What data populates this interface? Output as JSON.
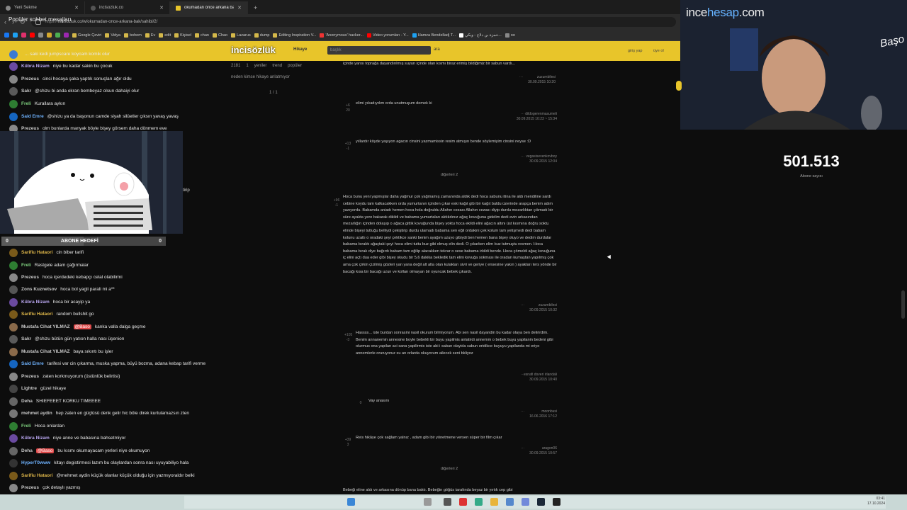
{
  "browser": {
    "tabs": [
      {
        "label": "Yeni Sekme"
      },
      {
        "label": "incisozluk.co"
      },
      {
        "label": "okumadan önce arkana bak - i..."
      }
    ],
    "new_tab": "+",
    "url_prefix": "https://",
    "url": "incisozluk.co/w/okumadan-once-arkana-bak/sahibi/2/",
    "back": "‹",
    "forward": "›",
    "reload": "↻",
    "bookmarks": [
      "Google Çeviri",
      "Vidya",
      "bohem",
      "Ev",
      "edit",
      "Kişisel",
      "chan",
      "Chao",
      "Lazarus",
      "dump",
      "Editing Inspiration V...",
      "'Anonymous' hacker...",
      "Video yorumları - Y...",
      "Hamza Bendelladj T...",
      "حمزة بن دلاج - ويكي...",
      "oo"
    ]
  },
  "site": {
    "logo": "incisözlük",
    "story_link": "Hikaye",
    "search_placeholder": "başlık",
    "search_button": "ara",
    "login": "giriş yap",
    "register": "üye ol",
    "thread_count": "2181",
    "tabs": [
      "1",
      "yeniler",
      "trend",
      "popüler"
    ],
    "subtitle": "neden kimse hikaye anlatmıyor",
    "page": "1 / 1"
  },
  "entries": [
    {
      "text": "içinde yarısı toprağa dayandırılmış suyun içinde olan kısmı biraz erimiş bildiğimiz bir sabun vardı...",
      "author": "zuzumbilesi",
      "date": "30.09.2015 10:20",
      "votes": ""
    },
    {
      "text": "elimi yıkadıydım orda unutmuşum demek ki",
      "author": "dildogerenmasumeli",
      "date": "30.09.2015 10:23 ~ 15:34",
      "votes": "+6 20"
    },
    {
      "text": "yıllardır köyde yaşıyon agacın cinsini yazmamissin resim atmışın bende söylemiyim cinsini neyse :D",
      "author": "vegasisevenkovboy",
      "date": "30.09.2015 12:04",
      "votes": "+13 -1"
    },
    {
      "text": "Hoca bunu yeni yapmışlar daha yağmur çok yağmamış zamanında aldık dedi hoca sabunu itina ile aldı mendiline sardı cebine koydu tam kalkacakken orda yumurtanın içinden çıkar eski kağıt gibi bir kağıt buldu üzerinde arapça benim adım yazıyordu. Babamda aniadı hemen hoca hola doğruldu Allahın cezası Allahın cezası diyip durdu mezarlıktan çıkmadı bir süre ayakta yere bakarak dikildi ve babama yumurtaları aldıkdınız ağaç kovuğuna gidelim dedi evin arkasından mezarlığın içinden dolaşıp o ağaca gittik kovuğunda bişey yoktu hoca ekildi elini ağacın altını üst kısmına doğru soktu elinde bişeyi tuttuğu belliydi çekiştirip durdu ulamadı babama sen eğil ordakini çek kolum tam yetişmedi dedi babam kolunu uzattı o oradaki şeyi çektikce sanki benim ayağım uzuyo gibiydi ben hemen bana bişey oluyo ve dedim durdular babama bıraktı ağaçtaki şeyi hoca elimi tuttu buz gibi olmuş elin dedi. O çıkarken elim buz tutmuştu resmen. Hoca babama bırak diye bağırdı babam tam eğilip alacakken tekrar o sese babama irkildi bende. Hoca çömeldi ağaç kovuğuna iç elini açtı dua eder gibi bişey okudu bir 5,6 dakika bekledik tam elini kovuğa sokması ile oradan kumaştan yapılmış çok ama çok çirkin çizilmiş gözleri yan yana değil alt alta olan kulakları sivri ve geriye ( ensesine yakın ) ayakları ters yönde bir bacağı kısa bir bacağı uzun ve kolları olmayan bir oyuncak bebek çıkardı.",
      "author": "zuzumbilesi",
      "date": "30.09.2015 10:32",
      "votes": "+96 -1"
    },
    {
      "text": "Hassss... iste burdan sonrasini nasil okurum bilmiyorum. Abi sen nasil dayandin bu kadar olaya ben delirirdim. Benim annanemin annesine boyle bebekli bir buyu yapilmis anlatirdi annemm o bebek buyu yapilanin bedeni gibi olurmus ona yapilan aci sana yapilirmis iste abi i sabun olayida sabun eridikce buyuyu yapilanda mi eriyo annemlerle oruruyoruz su an orlarda okuyorum ailecek seni bkliyoz",
      "author": "esnafi doveri irlandali",
      "date": "30.09.2015 10:40",
      "votes": "+105 -3"
    },
    {
      "text": "Vay anasını",
      "author": "moonbusi",
      "date": "16.06.2016 17:12",
      "votes": "0"
    },
    {
      "text": "Reis hikâye çok sağlam yalnız , adam gibi bir yönetmene versen süper bir film çıkar",
      "author": "aragon06",
      "date": "30.09.2015 10:57",
      "votes": "+39 3"
    },
    {
      "text": "Bebeği eline aldı ve arkasına dönüp bana baktı. Bebeğin göğüs tarafında beyaz bir yırtık cep gibi",
      "author": "",
      "date": "",
      "votes": ""
    }
  ],
  "dividers": [
    "diğerleri 2",
    "diğerleri 2"
  ],
  "chat": [
    {
      "user": "",
      "text": "... saki kedi jumpscare koycam komik olur",
      "color": "#9ad",
      "av": "#3a7ad4"
    },
    {
      "user": "Kübra Nizam",
      "text": "niye bu kadar sakin bu çocuk",
      "color": "#b9a6f0",
      "av": "#6a4aa0"
    },
    {
      "user": "Prezeus",
      "text": "cinci hocaya şaka yaptık sonuçları ağır oldu",
      "color": "#c8c8c8",
      "av": "#888"
    },
    {
      "user": "Sakr",
      "text": "@shizu bi anda ekran bembeyaz olsun dahaiyi olur",
      "color": "#c8c8c8",
      "av": "#5a5a5a"
    },
    {
      "user": "Freli",
      "text": "Kurallara aykırı",
      "color": "#7fd17f",
      "av": "#2e7d32"
    },
    {
      "user": "Said Emre",
      "text": "@shizu ya da başonun camde siyah silüetler çıksın yavaş yavaş",
      "color": "#6fb3ff",
      "av": "#1565c0"
    },
    {
      "user": "Prezeus",
      "text": "olm bunlarda manyak böyle bişey görsem daha dönmem eve",
      "color": "#c8c8c8",
      "av": "#888"
    },
    {
      "user": "Sarifiu Hataori",
      "text": "cin biber tarifi",
      "color": "#e0b84a",
      "av": "#7a5a1a"
    },
    {
      "user": "Freli",
      "text": "Rastgele adam çağırmalar",
      "color": "#7fd17f",
      "av": "#2e7d32"
    },
    {
      "user": "Prezeus",
      "text": "hoca içerdedeki kebapçı celal olabilirmi",
      "color": "#c8c8c8",
      "av": "#888"
    },
    {
      "user": "Zons Kuznetsov",
      "text": "hoca bol yagli parali mi a**",
      "color": "#c8c8c8",
      "av": "#555"
    },
    {
      "user": "Kübra Nizam",
      "text": "hoca bir acayip ya",
      "color": "#b9a6f0",
      "av": "#6a4aa0"
    },
    {
      "user": "Sarifiu Hataori",
      "text": "random bullshit go",
      "color": "#e0b84a",
      "av": "#7a5a1a"
    },
    {
      "user": "Mustafa Cihat YILMAZ",
      "text": "kanka valla dalga geçme",
      "mention": "@Baso",
      "color": "#c8c8c8",
      "av": "#8a6a4a"
    },
    {
      "user": "Sakr",
      "text": "@shizu bütün gün yatıon halla nası üşenion",
      "color": "#c8c8c8",
      "av": "#5a5a5a"
    },
    {
      "user": "Mustafa Cihat YILMAZ",
      "text": "baya sıkıntı bu işler",
      "color": "#c8c8c8",
      "av": "#8a6a4a"
    },
    {
      "user": "Said Emre",
      "text": "tarifesi var cin çıkarma, muska yapma, büyü bozma, adana kebap tarifi verme",
      "color": "#6fb3ff",
      "av": "#1565c0"
    },
    {
      "user": "Prezeus",
      "text": "zaten korkmuyorum (üstünlük belirtisi)",
      "color": "#c8c8c8",
      "av": "#888"
    },
    {
      "user": "Lightre",
      "text": "güzel hikaye",
      "color": "#c8c8c8",
      "av": "#444"
    },
    {
      "user": "Deha",
      "text": "SHIEFEEET KORKU TIMEEEE",
      "color": "#c8c8c8",
      "av": "#666"
    },
    {
      "user": "mehmet aydin",
      "text": "hep zaten en güçlüsü denk gelir hic böle direk kurtulamazsın zten",
      "color": "#c8c8c8",
      "av": "#777"
    },
    {
      "user": "Freli",
      "text": "Hoca onlardan",
      "color": "#7fd17f",
      "av": "#2e7d32"
    },
    {
      "user": "Kübra Nizam",
      "text": "niye anne ve babasına bahsetmiyor",
      "color": "#b9a6f0",
      "av": "#6a4aa0"
    },
    {
      "user": "Deha",
      "text": "bu kısmı okumayacam yerleri niye okumuyon",
      "mention": "@Baso",
      "color": "#c8c8c8",
      "av": "#666"
    },
    {
      "user": "HyperT0www",
      "text": "kitayı degistirmesi lazım bu olaylardan sonra nası uyuyabiliyo hala",
      "color": "#6fb3ff",
      "av": "#333"
    },
    {
      "user": "Sarifiu Hataori",
      "text": "@mehmet aydin küçük olanlar küçük olduğu için yazmıyoraldır belki",
      "color": "#e0b84a",
      "av": "#7a5a1a"
    },
    {
      "user": "Prezeus",
      "text": "çok detaylı yazmış",
      "color": "#c8c8c8",
      "av": "#888"
    },
    {
      "user": "mehmet aydin",
      "text": "hakikaten büyük cehaya hikaye çıkmazdı zten",
      "color": "#c8c8c8",
      "av": "#777"
    }
  ],
  "overlay": {
    "goal_label": "ABONE HEDEFİ",
    "goal_left": "0",
    "goal_right": "0",
    "goal_progress": 0.5,
    "tirip": "tirip"
  },
  "sidebar_chat_header": "Popüler sohbet mesajları",
  "stream": {
    "brand_a": "ince",
    "brand_b": "hesap",
    "brand_c": ".com",
    "logo": "Başo",
    "subscriber_count": "501.513",
    "subscriber_label": "Abone sayısı"
  },
  "clock": {
    "time": "03:41",
    "date": "17.10.2024"
  },
  "colors": {
    "site_yellow": "#e8c52a",
    "background": "#0d0d0d",
    "taskbar": "#c9d8d6"
  }
}
